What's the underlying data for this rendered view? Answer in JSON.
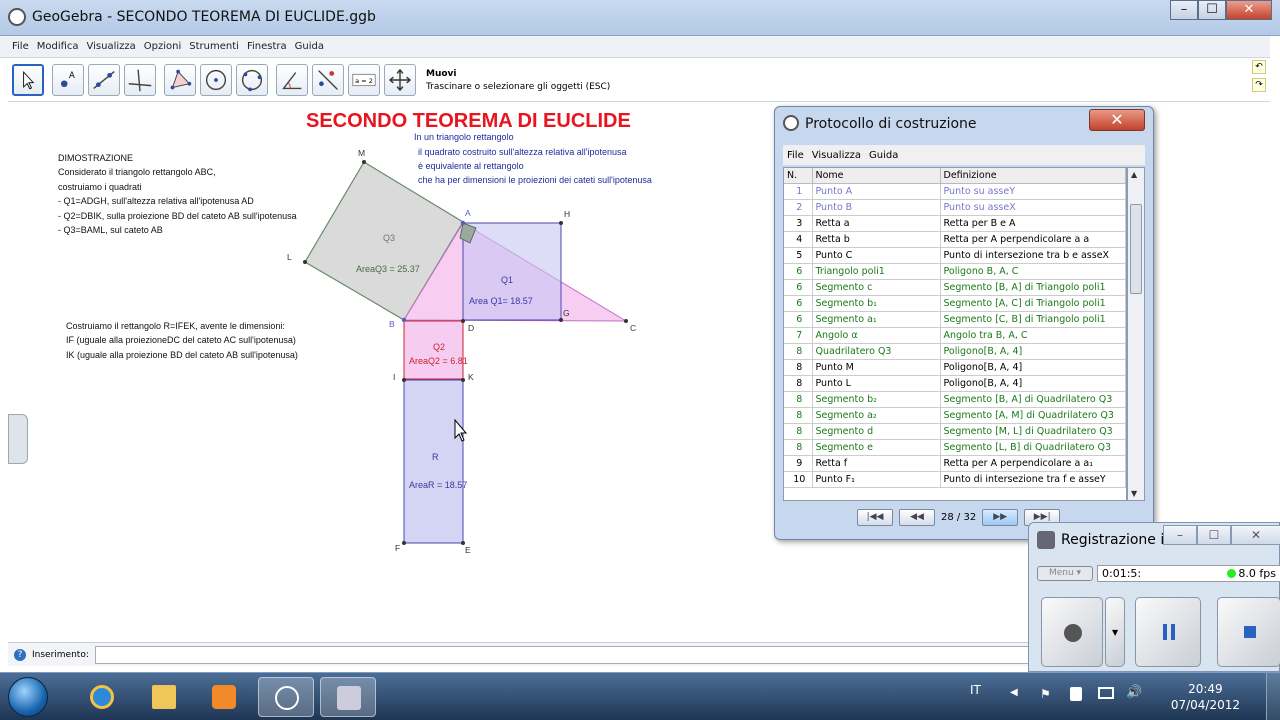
{
  "window": {
    "title": "GeoGebra - SECONDO TEOREMA DI EUCLIDE.ggb"
  },
  "menu": [
    "File",
    "Modifica",
    "Visualizza",
    "Opzioni",
    "Strumenti",
    "Finestra",
    "Guida"
  ],
  "toolbar": {
    "tool_name": "Muovi",
    "tool_help": "Trascinare o selezionare gli oggetti (ESC)",
    "segment_label": "a = 2"
  },
  "graphics": {
    "heading": "SECONDO TEOREMA DI EUCLIDE",
    "statement": [
      "In un triangolo rettangolo",
      "il quadrato costruito sull'altezza relativa all'ipotenusa",
      "è equivalente al rettangolo",
      "che ha per dimensioni le proiezioni dei cateti sull'ipotenusa"
    ],
    "proof": [
      "DIMOSTRAZIONE",
      "Considerato il triangolo rettangolo ABC,",
      "costruiamo i quadrati",
      " - Q1=ADGH, sull'altezza relativa all'ipotenusa AD",
      " - Q2=DBIK,  sulla proiezione BD del cateto AB sull'ipotenusa",
      " - Q3=BAML,  sul cateto AB"
    ],
    "rect_text": [
      "Costruiamo il rettangolo R=IFEK, avente le dimensioni:",
      "IF (uguale alla proiezioneDC del cateto AC sull'ipotenusa)",
      "IK (uguale alla proiezione BD del cateto AB sull'ipotenusa)"
    ],
    "points": {
      "M": "M",
      "A": "A",
      "H": "H",
      "L": "L",
      "B": "B",
      "D": "D",
      "G": "G",
      "C": "C",
      "I": "I",
      "K": "K",
      "F": "F",
      "E": "E"
    },
    "labels": {
      "q3": "Q3",
      "area_q3": "AreaQ3 = 25.37",
      "q1": "Q1",
      "area_q1": "Area Q1= 18.57",
      "q2": "Q2",
      "area_q2": "AreaQ2 = 6.81",
      "r": "R",
      "area_r": "AreaR  = 18.57"
    },
    "colors": {
      "heading": "#e8141e",
      "statement": "#1f2a9c",
      "q3": "#7a8a7a",
      "q1": "#3a3aa8",
      "q2": "#c8242f",
      "r": "#3a3a9a"
    }
  },
  "input": {
    "label": "Inserimento:"
  },
  "protocol": {
    "title": "Protocollo di costruzione",
    "menu": [
      "File",
      "Visualizza",
      "Guida"
    ],
    "headers": [
      "N.",
      "Nome",
      "Definizione"
    ],
    "rows": [
      {
        "n": "1",
        "name": "Punto A",
        "def": "Punto su asseY",
        "color": "#7777cc"
      },
      {
        "n": "2",
        "name": "Punto B",
        "def": "Punto su asseX",
        "color": "#7777cc"
      },
      {
        "n": "3",
        "name": "Retta a",
        "def": "Retta per B e A",
        "color": "#000000"
      },
      {
        "n": "4",
        "name": "Retta b",
        "def": "Retta per A perpendicolare a a",
        "color": "#000000"
      },
      {
        "n": "5",
        "name": "Punto C",
        "def": "Punto di intersezione tra b e asseX",
        "color": "#000000"
      },
      {
        "n": "6",
        "name": "Triangolo poli1",
        "def": "Poligono B, A, C",
        "color": "#1a7a1a"
      },
      {
        "n": "6",
        "name": "Segmento c",
        "def": "Segmento [B, A] di Triangolo poli1",
        "color": "#1a7a1a"
      },
      {
        "n": "6",
        "name": "Segmento b₁",
        "def": "Segmento [A, C] di Triangolo poli1",
        "color": "#1a7a1a"
      },
      {
        "n": "6",
        "name": "Segmento a₁",
        "def": "Segmento [C, B] di Triangolo poli1",
        "color": "#1a7a1a"
      },
      {
        "n": "7",
        "name": "Angolo α",
        "def": "Angolo tra B, A, C",
        "color": "#1a7a1a"
      },
      {
        "n": "8",
        "name": "Quadrilatero Q3",
        "def": "Poligono[B, A, 4]",
        "color": "#1a7a1a"
      },
      {
        "n": "8",
        "name": "Punto M",
        "def": "Poligono[B, A, 4]",
        "color": "#000000"
      },
      {
        "n": "8",
        "name": "Punto L",
        "def": "Poligono[B, A, 4]",
        "color": "#000000"
      },
      {
        "n": "8",
        "name": "Segmento b₂",
        "def": "Segmento [B, A] di Quadrilatero Q3",
        "color": "#1a7a1a"
      },
      {
        "n": "8",
        "name": "Segmento a₂",
        "def": "Segmento [A, M] di Quadrilatero Q3",
        "color": "#1a7a1a"
      },
      {
        "n": "8",
        "name": "Segmento d",
        "def": "Segmento [M, L] di Quadrilatero Q3",
        "color": "#1a7a1a"
      },
      {
        "n": "8",
        "name": "Segmento e",
        "def": "Segmento [L, B] di Quadrilatero Q3",
        "color": "#1a7a1a"
      },
      {
        "n": "9",
        "name": "Retta f",
        "def": "Retta per A perpendicolare a a₁",
        "color": "#000000"
      },
      {
        "n": "10",
        "name": "Punto F₁",
        "def": "Punto di intersezione tra f e asseY",
        "color": "#000000"
      }
    ],
    "nav": {
      "first": "|◀◀",
      "prev": "◀◀",
      "page": "28 / 32",
      "next": "▶▶",
      "last": "▶▶|"
    }
  },
  "recorder": {
    "title": "Registrazione i...",
    "menu": "Menu",
    "time": "0:01:5:",
    "fps": "8.0 fps"
  },
  "taskbar": {
    "lang": "IT",
    "time": "20:49",
    "date": "07/04/2012"
  }
}
